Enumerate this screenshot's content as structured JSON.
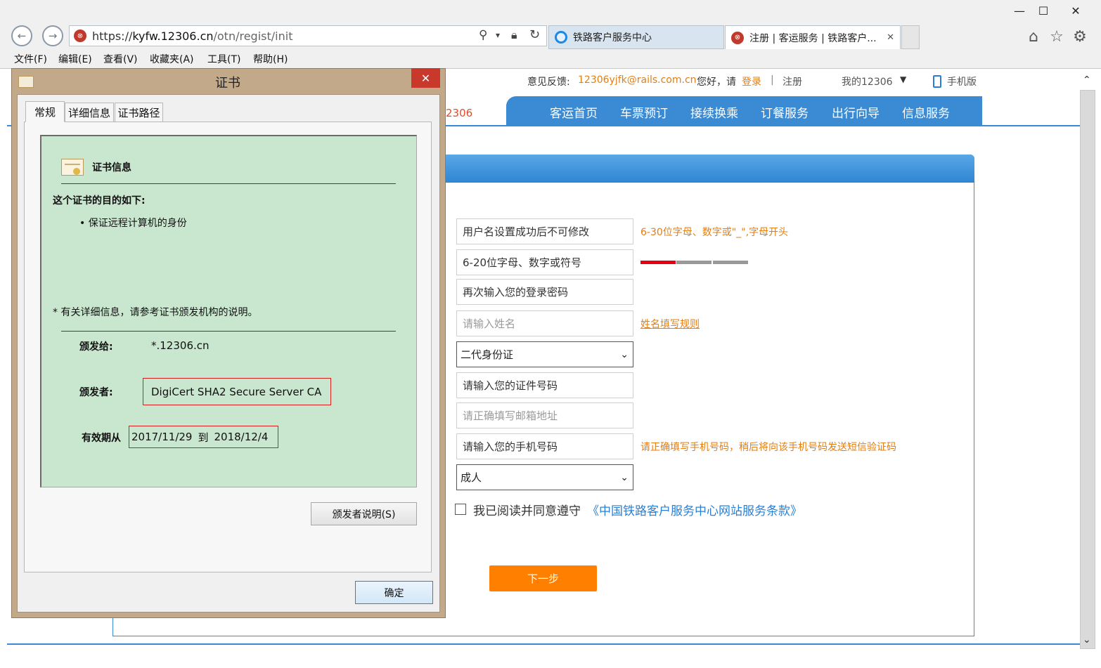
{
  "browser": {
    "url_prefix": "https://",
    "url_host": "kyfw.12306.cn",
    "url_path": "/otn/regist/init",
    "tabs": [
      {
        "label": "铁路客户服务中心"
      },
      {
        "label": "注册 | 客运服务 | 铁路客户..."
      }
    ],
    "tab_close": "✕",
    "menu": [
      "文件(F)",
      "编辑(E)",
      "查看(V)",
      "收藏夹(A)",
      "工具(T)",
      "帮助(H)"
    ],
    "window_controls": [
      "—",
      "☐",
      "✕"
    ]
  },
  "site": {
    "feedback_label": "意见反馈:",
    "feedback_email": "12306yjfk@rails.com.cn",
    "greeting": "您好，请",
    "login": "登录",
    "separator": "|",
    "register": "注册",
    "my12306": "我的12306",
    "mobile": "手机版",
    "logo_fragment": "2306",
    "nav": [
      "客运首页",
      "车票预订",
      "接续换乘",
      "订餐服务",
      "出行向导",
      "信息服务"
    ]
  },
  "form": {
    "username": "用户名设置成功后不可修改",
    "username_hint": "6-30位字母、数字或\"_\",字母开头",
    "password": "6-20位字母、数字或符号",
    "password_strength": 1,
    "confirm_password": "再次输入您的登录密码",
    "name_placeholder": "请输入姓名",
    "name_rule_link": "姓名填写规则",
    "id_type": "二代身份证",
    "id_number": "请输入您的证件号码",
    "email_placeholder": "请正确填写邮箱地址",
    "phone": "请输入您的手机号码",
    "phone_hint": "请正确填写手机号码，稍后将向该手机号码发送短信验证码",
    "passenger_type": "成人",
    "agree_text": "我已阅读并同意遵守",
    "agree_link": "《中国铁路客户服务中心网站服务条款》",
    "next_button": "下一步"
  },
  "dialog": {
    "title": "证书",
    "close": "✕",
    "tabs": [
      "常规",
      "详细信息",
      "证书路径"
    ],
    "section_title": "证书信息",
    "purpose_heading": "这个证书的目的如下:",
    "purpose_items": [
      "保证远程计算机的身份"
    ],
    "note": "* 有关详细信息，请参考证书颁发机构的说明。",
    "issued_to_label": "颁发给:",
    "issued_to": "*.12306.cn",
    "issued_by_label": "颁发者:",
    "issued_by": "DigiCert SHA2 Secure Server CA",
    "valid_label": "有效期从",
    "valid_from": "2017/11/29",
    "valid_to_word": "到",
    "valid_to": "2018/12/4",
    "issuer_statement_button": "颁发者说明(S)",
    "ok_button": "确定"
  },
  "colors": {
    "accent": "#3b8ad4",
    "hint_orange": "#e37e12",
    "next_button": "#ff8000",
    "cert_pane": "#c9e6cf",
    "dialog_frame": "#c2a98a",
    "highlight_box": "#d62020"
  }
}
